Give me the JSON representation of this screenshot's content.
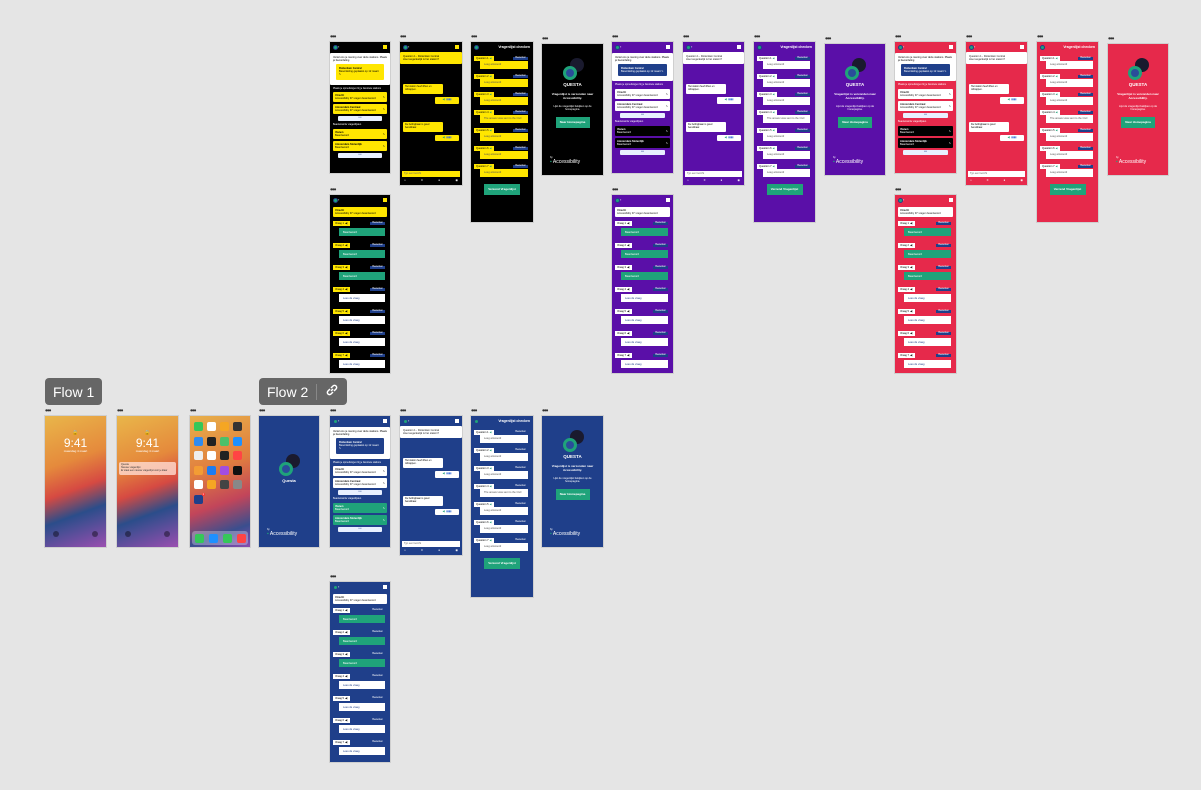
{
  "canvas": {
    "frame_menu": "•••",
    "flows": [
      {
        "label": "Flow 1"
      },
      {
        "label": "Flow 2"
      }
    ],
    "link_icon": "link-icon"
  },
  "lock": {
    "time": "9:41",
    "date": "maandag 4 maart",
    "notification": {
      "app": "Questa",
      "title": "Nieuwe vragenlijst",
      "body": "Er staat een nieuwe vragenlijst voor je klaar"
    }
  },
  "home": {
    "app_label": "Questa",
    "badge": "1"
  },
  "questa": {
    "logo_text": "QUESTA",
    "splash_text": "Questa",
    "message": "Vragenlijst is verzonden naar Accessibility.",
    "sub": "Lijst de vragenlijst bekijken op de homepagina.",
    "button": "Naar Homepagina",
    "by": "by",
    "brand": "Accessibility"
  },
  "form": {
    "intro": "Vertel ons je mening over deze stations. Plaats je beoordeling",
    "station": "Rotterdam Central",
    "station_sub": "Beoordeling geplaatst op 12 maart",
    "section1": "Plaats je opmerkingen bij je favoriete stations",
    "items1": [
      {
        "title": "Utrecht",
        "sub": "Accessibility 97 vragen beantwoord"
      },
      {
        "title": "Amsterdam Centraal",
        "sub": "Accessibility 97 vragen beantwoord"
      }
    ],
    "more": "•••",
    "section2": "Beantwoorde vragenlijsten",
    "items2": [
      {
        "title": "Vianen",
        "sub": "Beantwoord"
      },
      {
        "title": "Amsterdam Sloterdijk",
        "sub": "Beantwoord"
      }
    ],
    "edit_icon": "pencil-icon"
  },
  "chat": {
    "header": "Question 1 - Rotterdam Central",
    "sub": "Hoe toegankelijk is het station?",
    "msg1": "Het station heeft liften en roltrappen.",
    "msg2": "De hellingbaan is goed bereikbaar.",
    "input_placeholder": "Typ een bericht"
  },
  "check": {
    "title": "Vragenlijst checken",
    "questions": [
      "Question 1",
      "Question 2",
      "Question 3",
      "Question 4",
      "Question 5",
      "Question 6",
      "Question 7"
    ],
    "edit": "Bewerken",
    "answers": [
      "Leeg antwoord",
      "Leeg antwoord",
      "Leeg antwoord",
      "The answer was sent to the Civil",
      "Leeg antwoord",
      "Leeg antwoord",
      "Leeg antwoord"
    ],
    "submit": "Verzend Vragenlijst"
  },
  "answers": {
    "station": "Utrecht",
    "station_sub": "Accessibility 97 vragen beantwoord",
    "questions": [
      "Vraag 1",
      "Vraag 2",
      "Vraag 3",
      "Vraag 4",
      "Vraag 5",
      "Vraag 6",
      "Vraag 7"
    ],
    "answered": "Beantwoord",
    "empty": "Lees de vraag",
    "edit": "Bewerken"
  },
  "colors": {
    "yellow": "#ffe600",
    "purple": "#5a0fa8",
    "red": "#e6294b",
    "blue": "#1f3f8a",
    "green": "#1fa37a",
    "black": "#000000"
  }
}
